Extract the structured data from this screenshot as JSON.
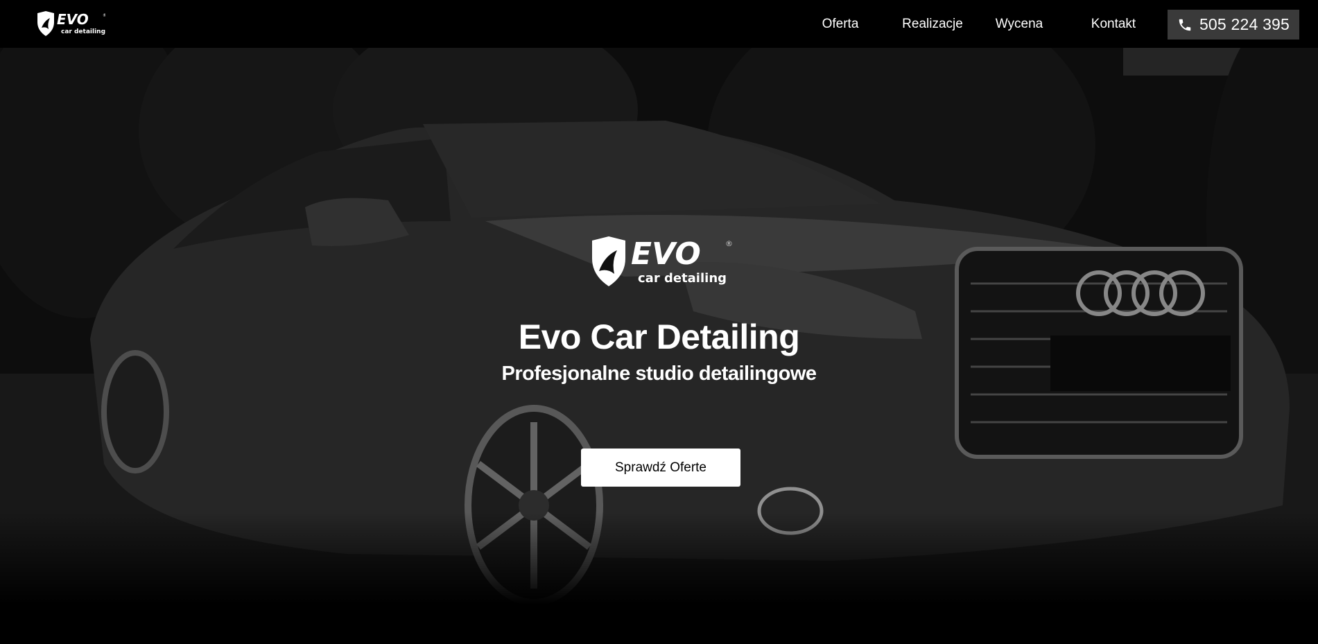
{
  "header": {
    "logo_alt": "EVO car detailing",
    "nav": [
      {
        "label": "Oferta"
      },
      {
        "label": "Realizacje"
      },
      {
        "label": "Wycena"
      },
      {
        "label": "Kontakt"
      }
    ],
    "phone": {
      "icon": "phone-icon",
      "number": "505 224 395"
    }
  },
  "hero": {
    "logo": {
      "brand": "EVO",
      "tagline": "car detailing",
      "registered": "®"
    },
    "title": "Evo Car Detailing",
    "subtitle": "Profesjonalne studio detailingowe",
    "cta_label": "Sprawdź Oferte",
    "background": "black-and-white photo of dark sedan"
  },
  "colors": {
    "header_bg": "#000000",
    "phone_btn_bg": "#3a3a3a",
    "cta_bg": "#ffffff",
    "cta_text": "#000000",
    "text": "#ffffff"
  }
}
